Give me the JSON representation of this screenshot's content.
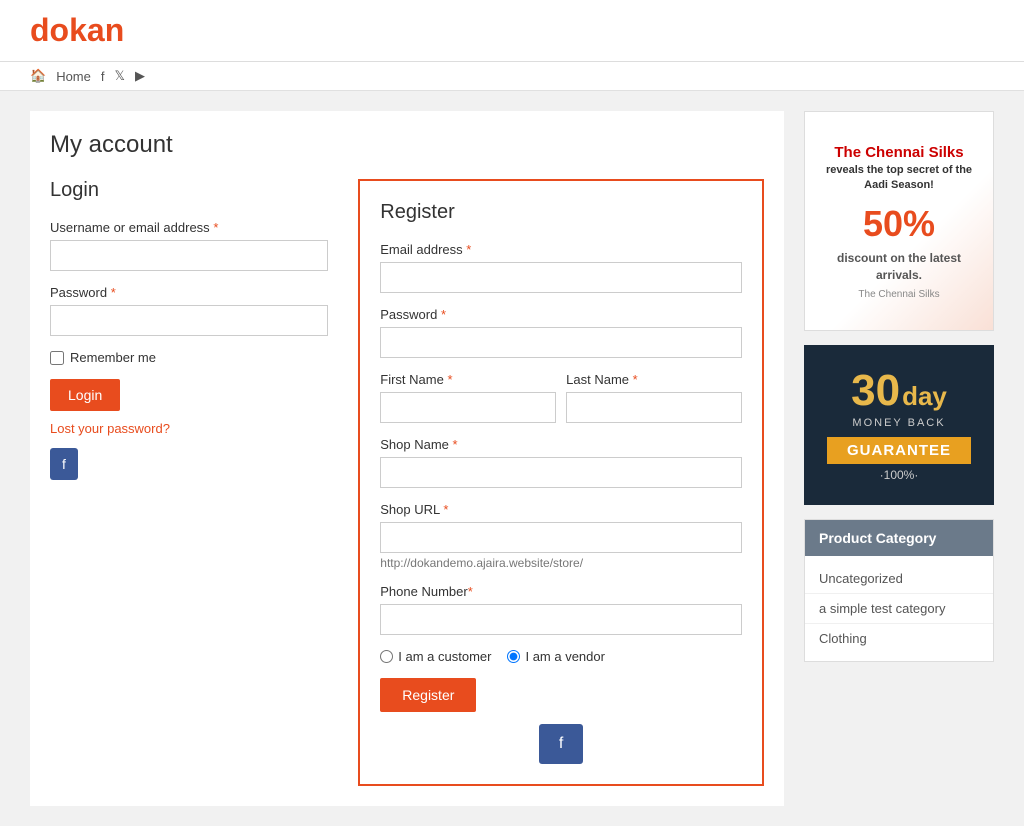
{
  "header": {
    "logo_prefix": "d",
    "logo_rest": "okan",
    "nav": {
      "home_label": "Home",
      "home_icon": "🏠",
      "facebook_icon": "f",
      "twitter_icon": "t",
      "youtube_icon": "▶"
    }
  },
  "page": {
    "title": "My account"
  },
  "login": {
    "title": "Login",
    "username_label": "Username or email address",
    "username_required": "*",
    "password_label": "Password",
    "password_required": "*",
    "remember_me_label": "Remember me",
    "login_button": "Login",
    "lost_password": "Lost your password?"
  },
  "register": {
    "title": "Register",
    "email_label": "Email address",
    "email_required": "*",
    "password_label": "Password",
    "password_required": "*",
    "first_name_label": "First Name",
    "first_name_required": "*",
    "last_name_label": "Last Name",
    "last_name_required": "*",
    "shop_name_label": "Shop Name",
    "shop_name_required": "*",
    "shop_url_label": "Shop URL",
    "shop_url_required": "*",
    "shop_url_hint": "http://dokandemo.ajaira.website/store/",
    "phone_label": "Phone Number",
    "phone_required": "*",
    "customer_radio": "I am a customer",
    "vendor_radio": "I am a vendor",
    "register_button": "Register"
  },
  "sidebar": {
    "ad_title_line1": "The Chennai Silks",
    "ad_title_line2": "reveals the top secret of the",
    "ad_title_line3": "Aadi Season!",
    "ad_discount": "50%",
    "ad_discount_text": "discount on the latest arrivals.",
    "ad_brand": "The Chennai Silks",
    "guarantee_30": "30",
    "guarantee_day": "day",
    "guarantee_money_back": "MONEY BACK",
    "guarantee_label": "GUARANTEE",
    "guarantee_pct": "·100%·",
    "product_category_header": "Product Category",
    "categories": [
      {
        "label": "Uncategorized"
      },
      {
        "label": "a simple test category"
      },
      {
        "label": "Clothing"
      }
    ]
  }
}
